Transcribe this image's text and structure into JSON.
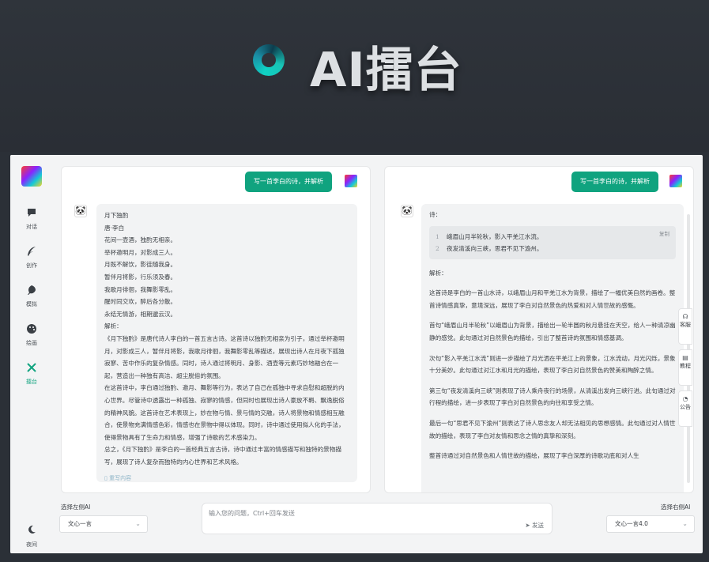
{
  "banner": {
    "title": "AI擂台"
  },
  "sidebar": {
    "items": [
      {
        "label": "对话",
        "icon": "chat-bubble-icon"
      },
      {
        "label": "创作",
        "icon": "feather-icon"
      },
      {
        "label": "模拟",
        "icon": "leaf-icon"
      },
      {
        "label": "绘画",
        "icon": "palette-icon"
      },
      {
        "label": "擂台",
        "icon": "cross-swords-icon"
      }
    ],
    "night_label": "夜间"
  },
  "left_panel": {
    "user_prompt": "写一首李白的诗，并解析",
    "response_lines": [
      "月下独酌",
      "唐·李白",
      "花间一壶酒，独酌无相亲。",
      "举杯邀明月，对影成三人。",
      "月既不解饮，影徒随我身。",
      "暂伴月将影，行乐须及春。",
      "我歌月徘徊，我舞影零乱。",
      "醒时同交欢，醉后各分散。",
      "永结无情游，相期邈云汉。",
      "解析：",
      "《月下独酌》是唐代诗人李白的一首五言古诗。这首诗以独酌无相亲为引子，通过举杯邀明月，对影成三人，暂伴月将影，我歌月徘徊，我舞影零乱等描述，展现出诗人在月夜下孤独寂寥、苦中作乐的复杂情感。同时，诗人通过将明月、身影、酒壶等元素巧妙地融合在一起，营造出一种独有高洁、超尘脱俗的氛围。",
      "在这首诗中，李白通过独酌、邀月、舞影等行为，表达了自己在孤独中寻求自慰和超脱的内心世界。尽管诗中透露出一种孤独、寂寥的情感，但同时也展现出诗人豪放不羁、飘逸脱俗的精神风貌。这首诗在艺术表现上，妙在物与情、景与情的交融，诗人将景物和情感相互融合，使景物充满情感色彩，情感也在景物中得以体现。同时，诗中通过使用拟人化的手法，使得景物具有了生命力和情感，增强了诗歌的艺术感染力。",
      "总之，《月下独酌》是李白的一首经典五言古诗，诗中通过丰富的情感描写和独特的景物描写，展现了诗人复杂而独特的内心世界和艺术风格。"
    ],
    "regen_label": "重写内容"
  },
  "right_panel": {
    "user_prompt": "写一首李白的诗，并解析",
    "poem_label": "诗：",
    "copy_label": "复制",
    "code_lines": [
      {
        "n": "1",
        "text": "峨眉山月半轮秋，影入平羌江水流。"
      },
      {
        "n": "2",
        "text": "夜发清溪向三峡，思君不见下渝州。"
      }
    ],
    "analysis_label": "解析：",
    "paragraphs": [
      "这首诗是李白的一首山水诗，以峨眉山月和平羌江水为背景，描绘了一幅优美自然的画卷。整首诗情感真挚，意境深远，展现了李白对自然景色的热爱和对人情世故的感慨。",
      "首句“峨眉山月半轮秋”以峨眉山为背景，描绘出一轮半圆的秋月悬挂在天空，给人一种清凉幽静的感觉。此句通过对自然景色的描绘，引出了整首诗的氛围和情感基调。",
      "次句“影入平羌江水流”则进一步描绘了月光洒在平羌江上的景象，江水流动，月光闪烁，景象十分美妙。此句通过对江水和月光的描绘，表现了李白对自然景色的赞美和陶醉之情。",
      "第三句“夜发清溪向三峡”则表现了诗人乘舟夜行的场景，从清溪出发向三峡行进。此句通过对行程的描绘，进一步表现了李白对自然景色的向往和享受之情。",
      "最后一句“思君不见下渝州”则表达了诗人思念友人却无法相见的思想感情。此句通过对人情世故的描绘，表现了李白对友情和思念之情的真挚和深刻。",
      "整首诗通过对自然景色和人情世故的描绘，展现了李白深厚的诗歌功底和对人生"
    ]
  },
  "bottom": {
    "left_select_label": "选择左侧AI",
    "left_select_value": "文心一言",
    "input_placeholder": "输入您的问题，Ctrl+回车发送",
    "send_label": "发送",
    "right_select_label": "选择右侧AI",
    "right_select_value": "文心一言4.0"
  },
  "float_tabs": [
    {
      "label": "客服",
      "icon": "headset-icon"
    },
    {
      "label": "教程",
      "icon": "book-icon"
    },
    {
      "label": "公告",
      "icon": "bell-icon"
    }
  ],
  "colors": {
    "accent": "#10a37f",
    "banner_bg": "#2b3037",
    "app_bg": "#f3f4f5"
  }
}
